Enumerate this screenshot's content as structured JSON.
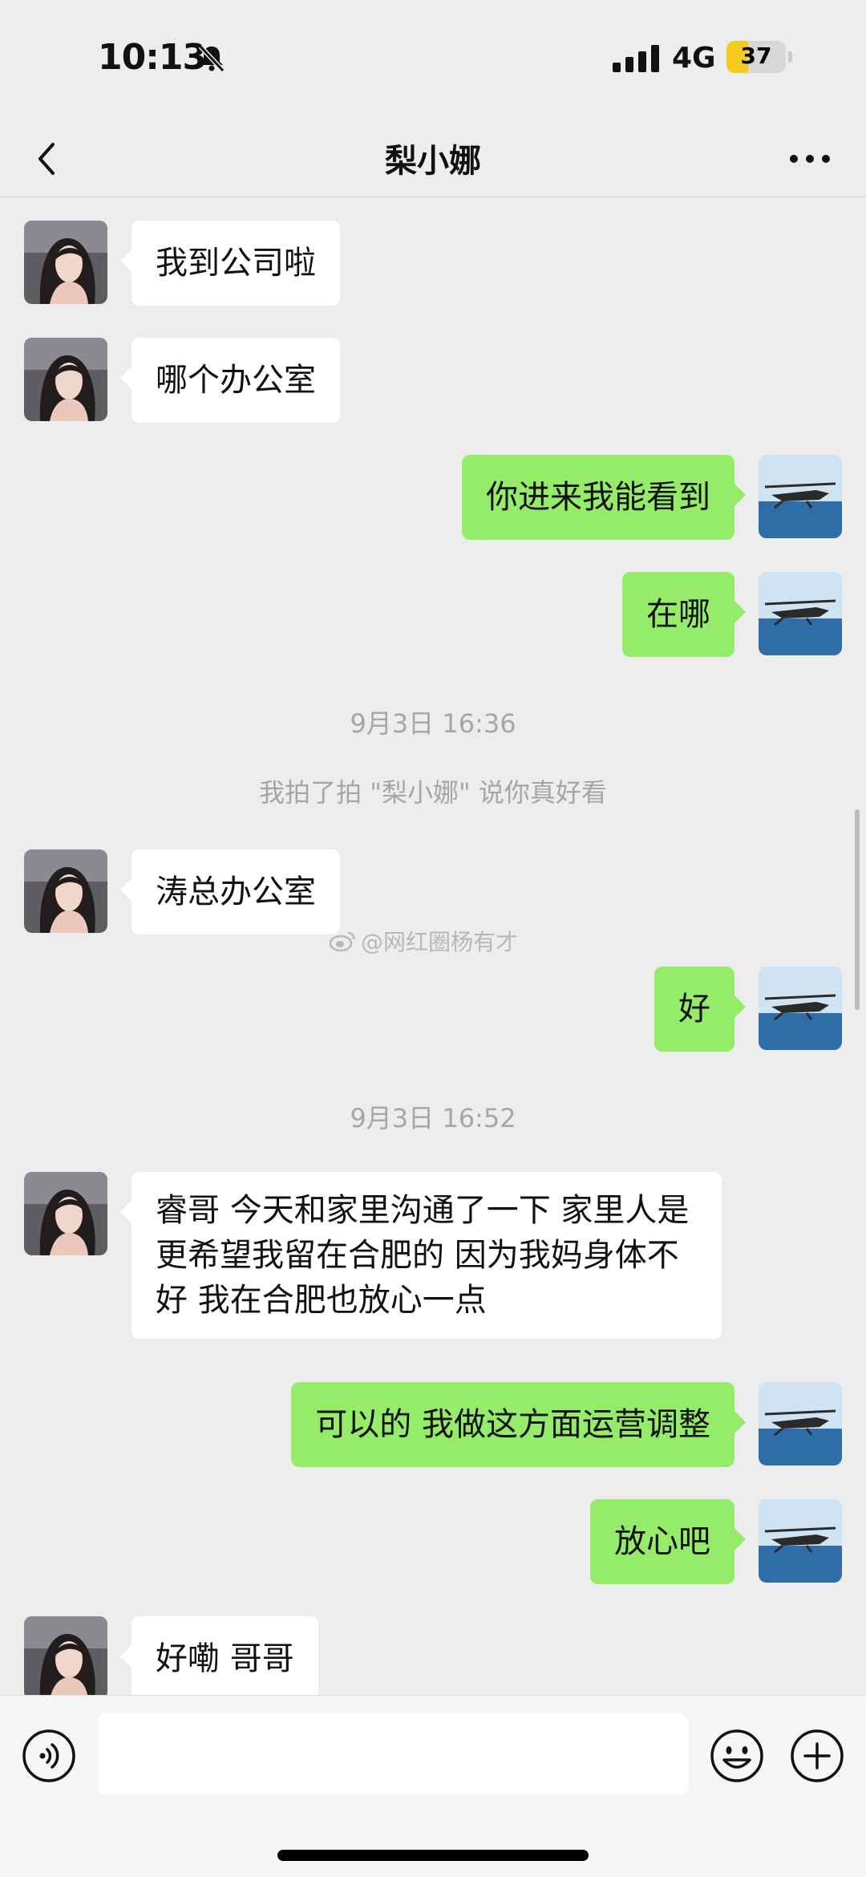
{
  "status_bar": {
    "time": "10:13",
    "network": "4G",
    "battery": "37",
    "battery_level": 0.37,
    "icons": [
      "bell-slash-icon",
      "signal-bars-icon"
    ]
  },
  "nav": {
    "title": "梨小娜",
    "icons": [
      "chevron-left-icon",
      "more-dots-icon"
    ]
  },
  "messages": {
    "m1": "我到公司啦",
    "m2": "哪个办公室",
    "m3": "你进来我能看到",
    "m4": "在哪",
    "t1": "9月3日 16:36",
    "pat": "我拍了拍 \"梨小娜\" 说你真好看",
    "m5": "涛总办公室",
    "m6": "好",
    "t2": "9月3日 16:52",
    "m7": "睿哥 今天和家里沟通了一下 家里人是更希望我留在合肥的 因为我妈身体不好 我在合肥也放心一点",
    "m8": "可以的 我做这方面运营调整",
    "m9": "放心吧",
    "m10": "好嘞 哥哥"
  },
  "watermark": "@网红圈杨有才",
  "input_bar": {
    "value": "",
    "icons": [
      "voice-icon",
      "emoji-icon",
      "plus-icon"
    ]
  },
  "colors": {
    "background": "#ededed",
    "sent_bubble": "#95ec69",
    "received_bubble": "#ffffff",
    "battery_fill": "#f5cc1e"
  }
}
